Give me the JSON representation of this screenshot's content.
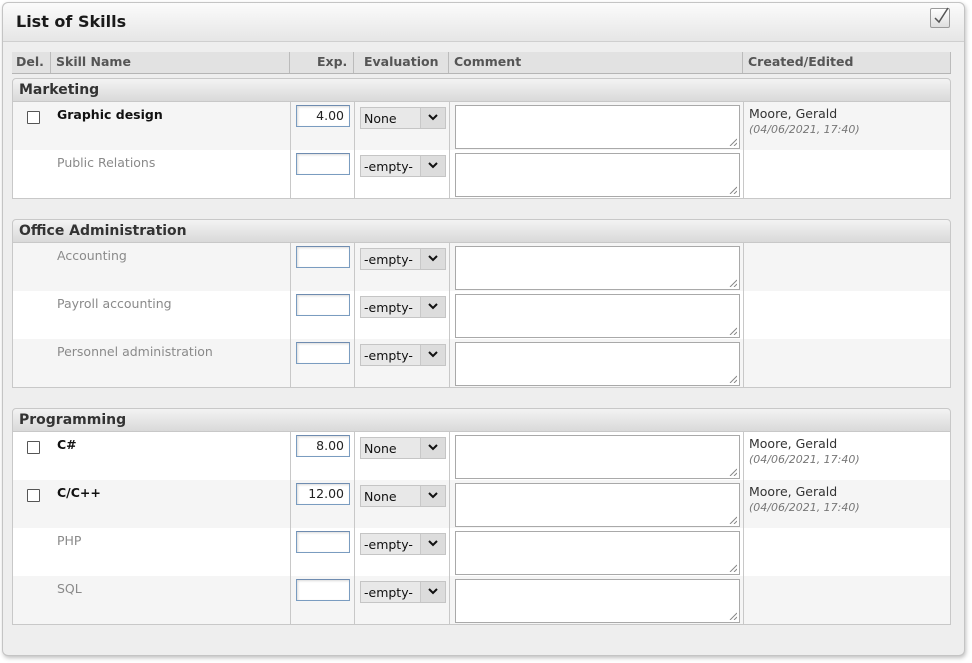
{
  "panel": {
    "title": "List of Skills"
  },
  "columns": {
    "del": "Del.",
    "skill_name": "Skill Name",
    "exp": "Exp.",
    "evaluation": "Evaluation",
    "comment": "Comment",
    "created_edited": "Created/Edited"
  },
  "sections": [
    {
      "title": "Marketing",
      "rows": [
        {
          "skill": "Graphic design",
          "exp": "4.00",
          "evaluation": "None",
          "created_by": "Moore, Gerald",
          "created_at": "(04/06/2021, 17:40)"
        },
        {
          "skill": "Public Relations",
          "exp": "",
          "evaluation": "-empty-",
          "created_by": "",
          "created_at": ""
        }
      ]
    },
    {
      "title": "Office Administration",
      "rows": [
        {
          "skill": "Accounting",
          "exp": "",
          "evaluation": "-empty-",
          "created_by": "",
          "created_at": ""
        },
        {
          "skill": "Payroll accounting",
          "exp": "",
          "evaluation": "-empty-",
          "created_by": "",
          "created_at": ""
        },
        {
          "skill": "Personnel administration",
          "exp": "",
          "evaluation": "-empty-",
          "created_by": "",
          "created_at": ""
        }
      ]
    },
    {
      "title": "Programming",
      "rows": [
        {
          "skill": "C#",
          "exp": "8.00",
          "evaluation": "None",
          "created_by": "Moore, Gerald",
          "created_at": "(04/06/2021, 17:40)"
        },
        {
          "skill": "C/C++",
          "exp": "12.00",
          "evaluation": "None",
          "created_by": "Moore, Gerald",
          "created_at": "(04/06/2021, 17:40)"
        },
        {
          "skill": "PHP",
          "exp": "",
          "evaluation": "-empty-",
          "created_by": "",
          "created_at": ""
        },
        {
          "skill": "SQL",
          "exp": "",
          "evaluation": "-empty-",
          "created_by": "",
          "created_at": ""
        }
      ]
    }
  ]
}
